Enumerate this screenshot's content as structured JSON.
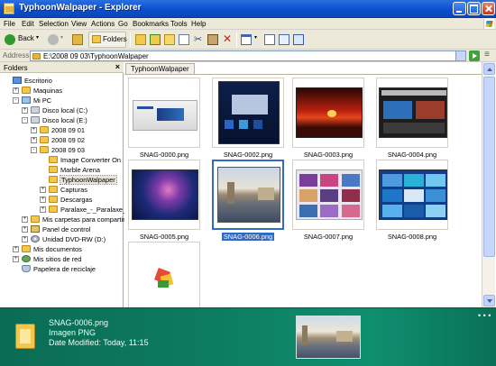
{
  "window": {
    "title": "TyphoonWalpaper - Explorer"
  },
  "menubar": {
    "items": [
      "File",
      "Edit",
      "Selection",
      "View",
      "Actions",
      "Go",
      "Bookmarks",
      "Tools",
      "Help"
    ]
  },
  "toolbar": {
    "back_label": "Back",
    "folders_label": "Folders"
  },
  "address": {
    "label": "Address",
    "value": "E:\\2008 09 03\\TyphoonWalpaper"
  },
  "folders_pane": {
    "title": "Folders",
    "close_glyph": "×",
    "tree": [
      {
        "label": "Escritorio",
        "icon": "desktop-icon",
        "expander": ""
      },
      {
        "label": "Maquinas",
        "icon": "folder-icon",
        "expander": "+"
      },
      {
        "label": "Mi PC",
        "icon": "computer-icon",
        "expander": "-"
      },
      {
        "label": "Disco local (C:)",
        "icon": "drive-icon",
        "expander": "+"
      },
      {
        "label": "Disco local (E:)",
        "icon": "drive-icon",
        "expander": "-"
      },
      {
        "label": "2008 09 01",
        "icon": "folder-icon",
        "expander": "+"
      },
      {
        "label": "2008 09 02",
        "icon": "folder-icon",
        "expander": "+"
      },
      {
        "label": "2008 09 03",
        "icon": "folder-icon",
        "expander": "-"
      },
      {
        "label": "Image Converter On",
        "icon": "folder-icon",
        "expander": ""
      },
      {
        "label": "Marble Arena",
        "icon": "folder-icon",
        "expander": ""
      },
      {
        "label": "TyphoonWalpaper",
        "icon": "folder-icon",
        "expander": ""
      },
      {
        "label": "Capturas",
        "icon": "folder-icon",
        "expander": "+"
      },
      {
        "label": "Descargas",
        "icon": "folder-icon",
        "expander": "+"
      },
      {
        "label": "Paralaxe_-_Paralaxe_20",
        "icon": "folder-icon",
        "expander": "+"
      },
      {
        "label": "Mis carpetas para compartir",
        "icon": "folder-icon",
        "expander": "+"
      },
      {
        "label": "Panel de control",
        "icon": "control-panel-icon",
        "expander": "+"
      },
      {
        "label": "Unidad DVD-RW (D:)",
        "icon": "dvd-icon",
        "expander": "+"
      },
      {
        "label": "Mis documentos",
        "icon": "folder-icon",
        "expander": "+"
      },
      {
        "label": "Mis sitios de red",
        "icon": "network-icon",
        "expander": "+"
      },
      {
        "label": "Papelera de reciclaje",
        "icon": "recycle-bin-icon",
        "expander": ""
      }
    ]
  },
  "content": {
    "tab_label": "TyphoonWalpaper",
    "thumbnails": [
      {
        "name": "SNAG-0000.png"
      },
      {
        "name": "SNAG-0002.png"
      },
      {
        "name": "SNAG-0003.png"
      },
      {
        "name": "SNAG-0004.png"
      },
      {
        "name": "SNAG-0005.png"
      },
      {
        "name": "SNAG-0006.png"
      },
      {
        "name": "SNAG-0007.png"
      },
      {
        "name": "SNAG-0008.png"
      },
      {
        "name": ""
      }
    ]
  },
  "details": {
    "filename": "SNAG-0006.png",
    "type": "Imagen PNG",
    "modified": "Date Modified: Today, 11:15",
    "more": "• • •"
  }
}
